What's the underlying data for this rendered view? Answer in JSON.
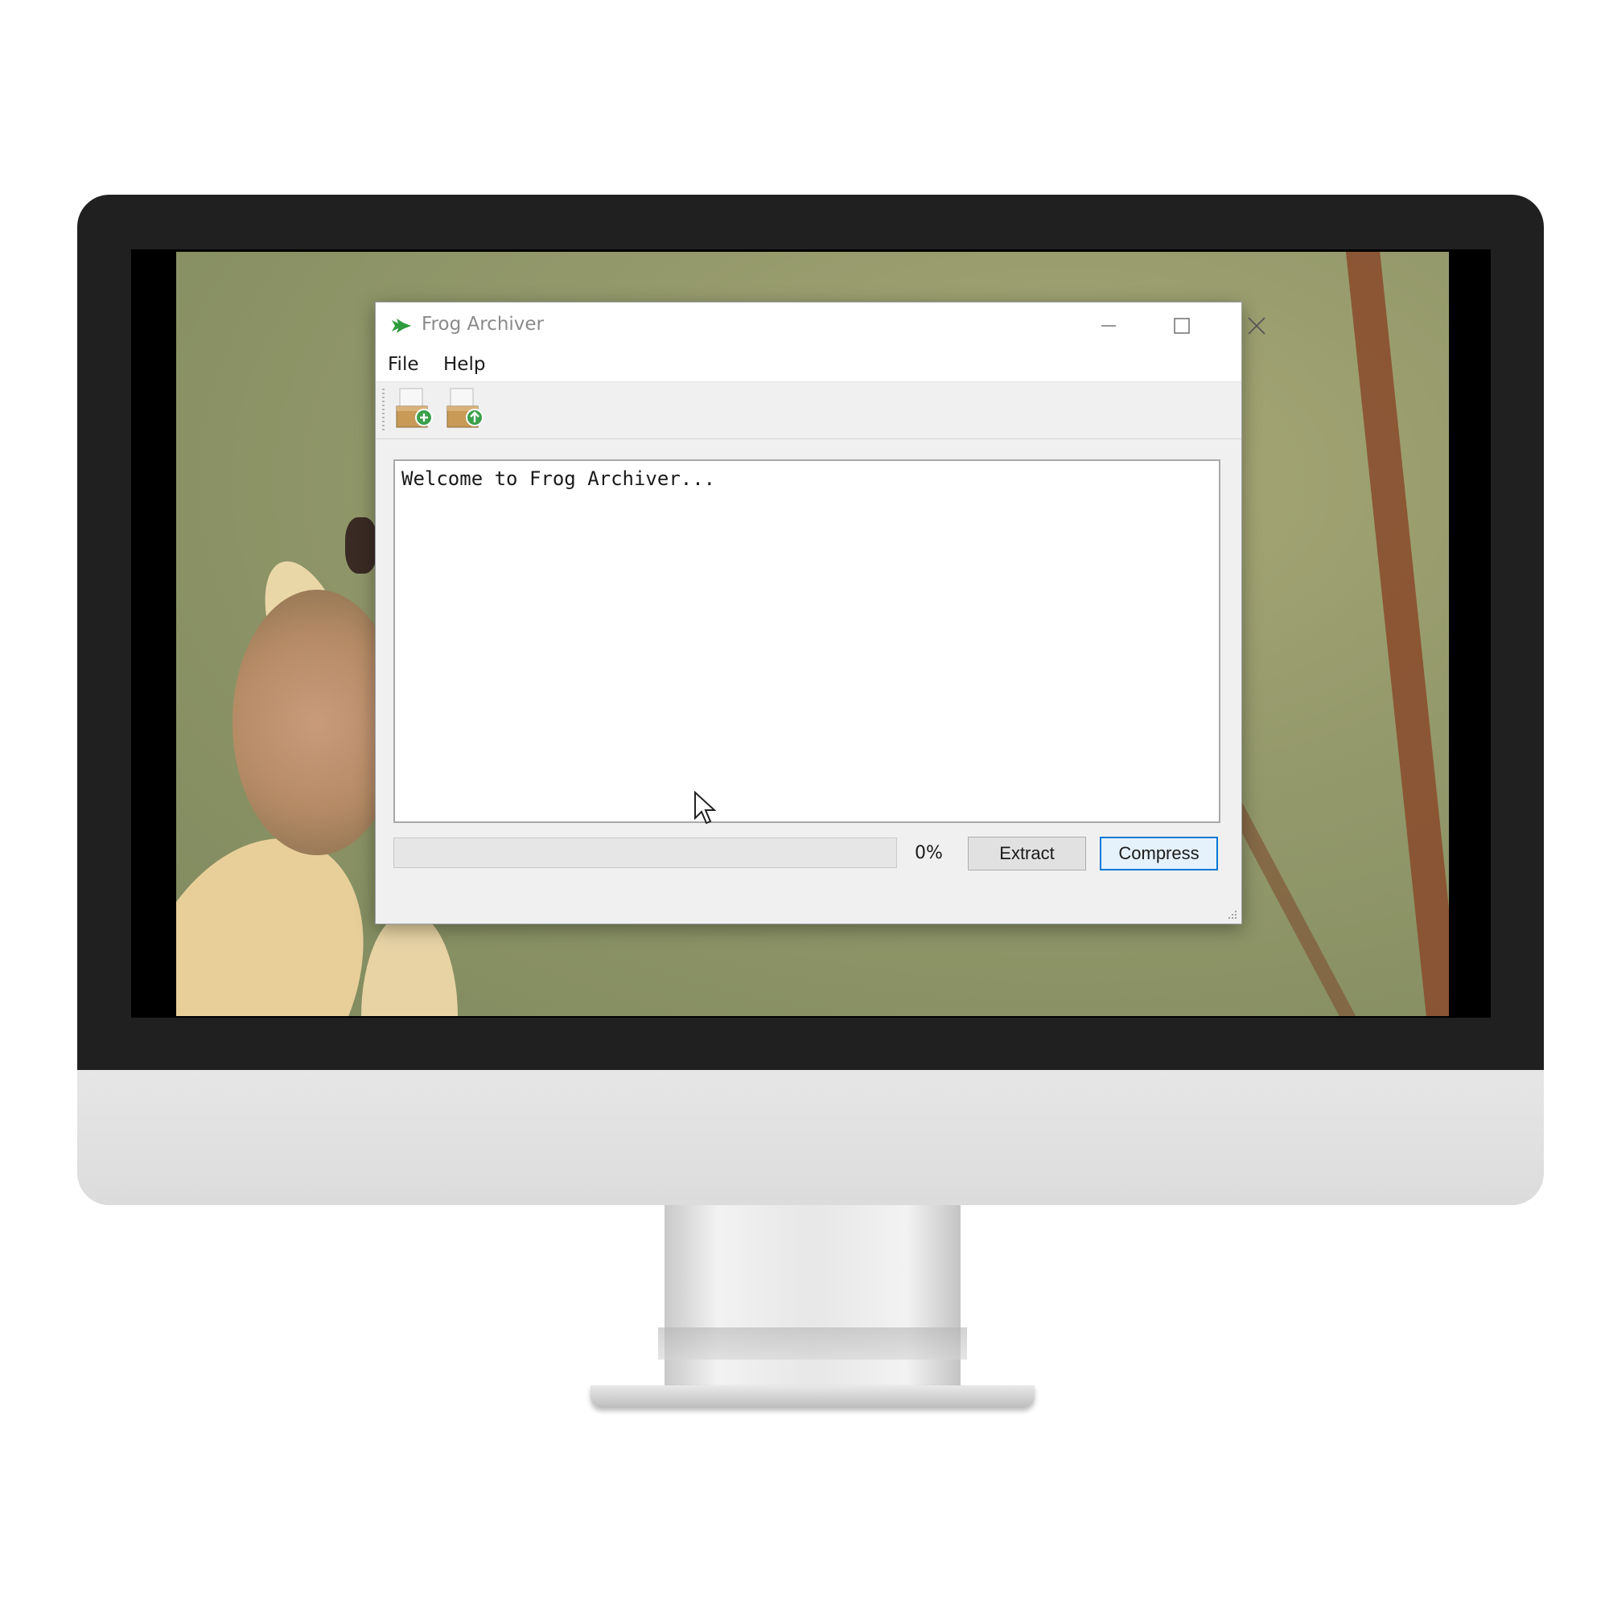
{
  "window": {
    "title": "Frog Archiver",
    "controls": {
      "minimize": "minimize-icon",
      "maximize": "maximize-icon",
      "close": "close-icon"
    }
  },
  "menu": {
    "items": [
      {
        "label": "File"
      },
      {
        "label": "Help"
      }
    ]
  },
  "toolbar": {
    "buttons": [
      {
        "icon": "add-to-archive-icon"
      },
      {
        "icon": "extract-archive-icon"
      }
    ]
  },
  "log": {
    "text": "Welcome to Frog Archiver..."
  },
  "progress": {
    "value": 0,
    "label": "0%"
  },
  "actions": {
    "extract_label": "Extract",
    "compress_label": "Compress"
  },
  "colors": {
    "accent": "#0078d7",
    "progress_fill": "#06b025",
    "app_icon": "#2e9b3c"
  }
}
